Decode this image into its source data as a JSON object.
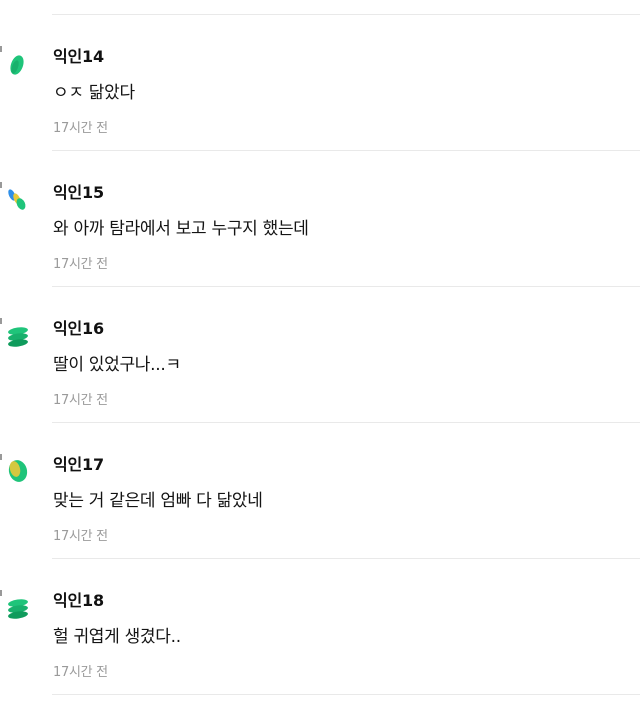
{
  "comments": [
    {
      "author": "익인14",
      "text": "ㅇㅈ 닮았다",
      "time": "17시간 전",
      "avatar_icon": "green-oval-avatar-icon"
    },
    {
      "author": "익인15",
      "text": "와 아까 탐라에서 보고 누구지 했는데",
      "time": "17시간 전",
      "avatar_icon": "blue-green-pills-avatar-icon"
    },
    {
      "author": "익인16",
      "text": "딸이 있었구나...ㅋ",
      "time": "17시간 전",
      "avatar_icon": "green-stack-avatar-icon"
    },
    {
      "author": "익인17",
      "text": "맞는 거 같은데 엄빠 다 닮았네",
      "time": "17시간 전",
      "avatar_icon": "yellow-green-oval-avatar-icon"
    },
    {
      "author": "익인18",
      "text": "헐 귀엽게 생겼다..",
      "time": "17시간 전",
      "avatar_icon": "green-stack-avatar-icon"
    }
  ],
  "colors": {
    "green": "#1fc47a",
    "dark_green": "#0f9b5c",
    "blue": "#2f8fe8",
    "yellow": "#e8c93a",
    "divider": "#e9e9e9",
    "timestamp": "#9a9a9a"
  }
}
